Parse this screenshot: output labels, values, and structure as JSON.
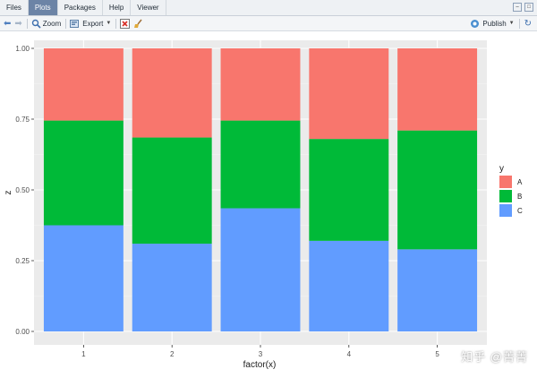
{
  "tabs": [
    {
      "label": "Files"
    },
    {
      "label": "Plots"
    },
    {
      "label": "Packages"
    },
    {
      "label": "Help"
    },
    {
      "label": "Viewer"
    }
  ],
  "toolbar": {
    "zoom_label": "Zoom",
    "export_label": "Export",
    "publish_label": "Publish"
  },
  "watermark": "知乎 @菁菁",
  "chart_data": {
    "type": "bar",
    "stacked": true,
    "normalized": true,
    "categories": [
      "1",
      "2",
      "3",
      "4",
      "5"
    ],
    "series": [
      {
        "name": "A",
        "color": "#f8766d",
        "values": [
          0.255,
          0.315,
          0.255,
          0.32,
          0.29
        ]
      },
      {
        "name": "B",
        "color": "#00ba38",
        "values": [
          0.37,
          0.375,
          0.31,
          0.36,
          0.42
        ]
      },
      {
        "name": "C",
        "color": "#619cff",
        "values": [
          0.375,
          0.31,
          0.435,
          0.32,
          0.29
        ]
      }
    ],
    "xlabel": "factor(x)",
    "ylabel": "z",
    "ylim": [
      0,
      1
    ],
    "yticks": [
      "0.00",
      "0.25",
      "0.50",
      "0.75",
      "1.00"
    ],
    "legend_title": "y",
    "legend_position": "right",
    "background": "#ebebeb",
    "grid": true
  }
}
